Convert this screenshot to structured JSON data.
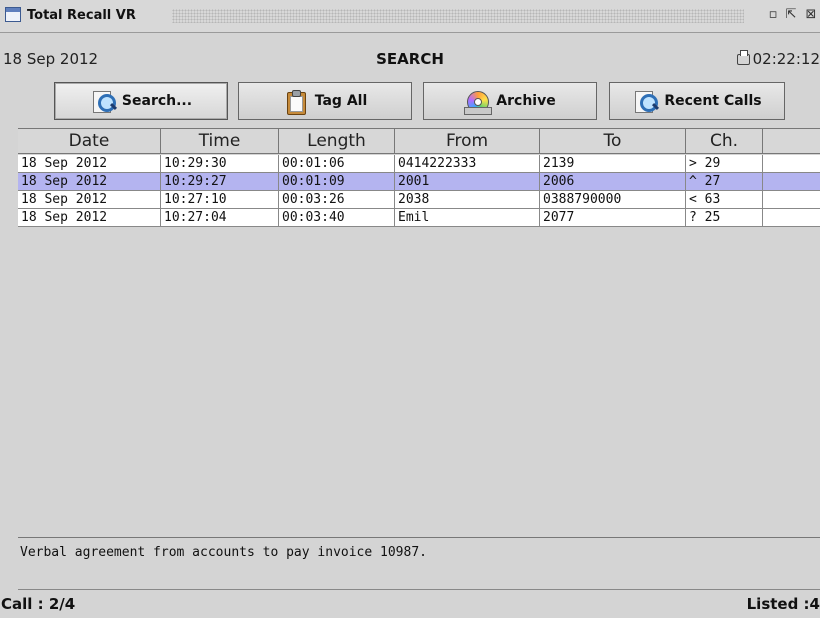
{
  "window": {
    "title": "Total Recall VR",
    "controls": {
      "minimize": "▫",
      "maximize": "⇱",
      "close": "⊠"
    }
  },
  "header": {
    "date": "18 Sep 2012",
    "screen_title": "SEARCH",
    "clock": "02:22:12"
  },
  "toolbar": {
    "buttons": [
      {
        "label": "Search...",
        "icon": "search-icon"
      },
      {
        "label": "Tag All",
        "icon": "clipboard-icon"
      },
      {
        "label": "Archive",
        "icon": "disc-icon"
      },
      {
        "label": "Recent Calls",
        "icon": "search-icon"
      }
    ]
  },
  "table": {
    "columns": [
      "Date",
      "Time",
      "Length",
      "From",
      "To",
      "Ch.",
      ""
    ],
    "rows": [
      {
        "date": "18 Sep 2012",
        "time": "10:29:30",
        "length": "00:01:06",
        "from": "0414222333",
        "to": "2139",
        "ch": "> 29",
        "extra": ""
      },
      {
        "date": "18 Sep 2012",
        "time": "10:29:27",
        "length": "00:01:09",
        "from": "2001",
        "to": "2006",
        "ch": "^ 27",
        "extra": ""
      },
      {
        "date": "18 Sep 2012",
        "time": "10:27:10",
        "length": "00:03:26",
        "from": "2038",
        "to": "0388790000",
        "ch": "< 63",
        "extra": ""
      },
      {
        "date": "18 Sep 2012",
        "time": "10:27:04",
        "length": "00:03:40",
        "from": "Emil",
        "to": "2077",
        "ch": "? 25",
        "extra": ""
      }
    ],
    "selected_row": 1,
    "colors": {
      "selected": "#b4b4f0",
      "row": "#ffffff"
    }
  },
  "notes": {
    "text": "Verbal agreement from accounts to pay invoice 10987."
  },
  "status": {
    "call": "Call : 2/4",
    "listed": "Listed :4"
  }
}
